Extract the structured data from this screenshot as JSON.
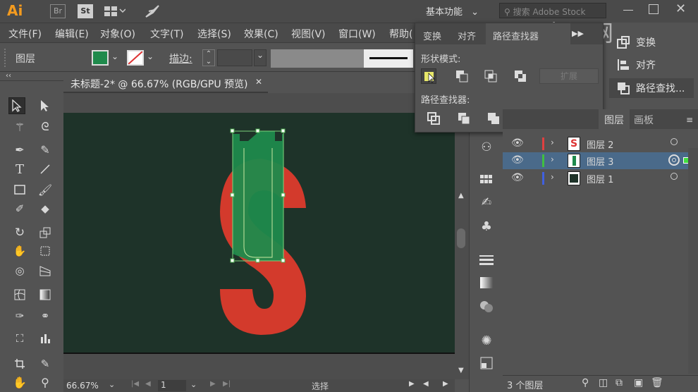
{
  "app": {
    "logo": "Ai",
    "bridge": "Br",
    "stock": "St",
    "workspace": "基本功能",
    "search_placeholder": "搜索 Adobe Stock"
  },
  "menu": [
    "文件(F)",
    "编辑(E)",
    "对象(O)",
    "文字(T)",
    "选择(S)",
    "效果(C)",
    "视图(V)",
    "窗口(W)",
    "帮助("
  ],
  "controlbar": {
    "label": "图层",
    "stroke_label": "描边:",
    "fill_color": "#1f8a4c"
  },
  "document": {
    "tab_title": "未标题-2* @ 66.67% (RGB/GPU 预览)"
  },
  "pathfinder": {
    "tabs": [
      "变换",
      "对齐",
      "路径查找器"
    ],
    "shape_modes_label": "形状模式:",
    "pathfinders_label": "路径查找器:",
    "expand_label": "扩展"
  },
  "side_panel": {
    "items": [
      "变换",
      "对齐",
      "路径查找..."
    ]
  },
  "layers_panel": {
    "tabs": [
      "图层",
      "画板"
    ],
    "layers": [
      {
        "name": "图层 2",
        "color": "#e04040"
      },
      {
        "name": "图层 3",
        "color": "#40c040"
      },
      {
        "name": "图层 1",
        "color": "#4060e0"
      }
    ],
    "count_label": "3 个图层"
  },
  "status": {
    "zoom": "66.67%",
    "page": "1",
    "tool": "选择"
  },
  "watermark": "虎课网"
}
